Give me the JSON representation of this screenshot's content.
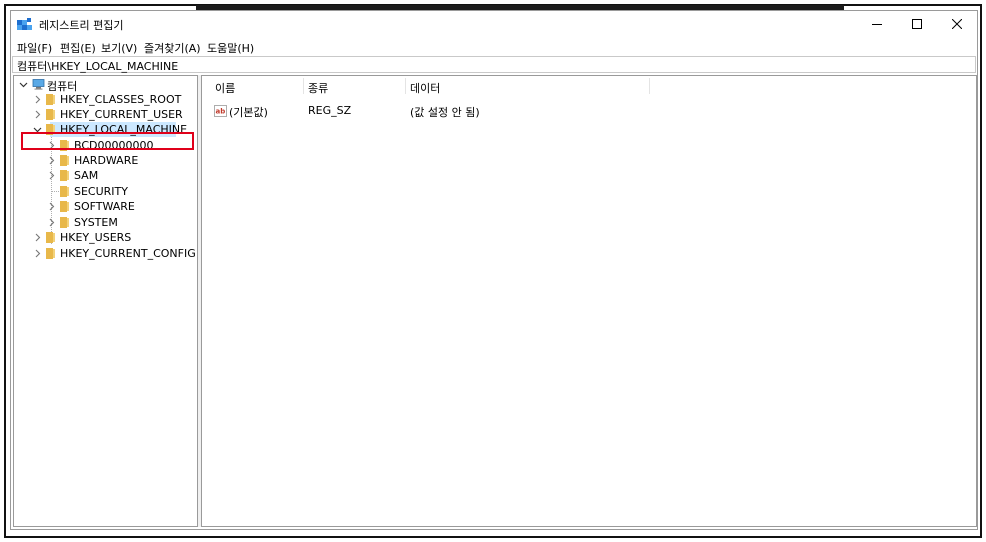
{
  "window": {
    "title": "레지스트리 편집기",
    "controls": [
      "minimize",
      "maximize",
      "close"
    ]
  },
  "menu": [
    "파일(F)",
    "편집(E)",
    "보기(V)",
    "즐겨찾기(A)",
    "도움말(H)"
  ],
  "address": "컴퓨터\\HKEY_LOCAL_MACHINE",
  "tree": {
    "root": "컴퓨터",
    "hives": [
      "HKEY_CLASSES_ROOT",
      "HKEY_CURRENT_USER",
      "HKEY_LOCAL_MACHINE"
    ],
    "local_machine_children": [
      "BCD00000000",
      "HARDWARE",
      "SAM",
      "SECURITY",
      "SOFTWARE",
      "SYSTEM"
    ],
    "hives_after": [
      "HKEY_USERS",
      "HKEY_CURRENT_CONFIG"
    ],
    "selected": "HKEY_LOCAL_MACHINE"
  },
  "list": {
    "columns": [
      "이름",
      "종류",
      "데이터"
    ],
    "rows": [
      {
        "icon": "ab",
        "name": "(기본값)",
        "type": "REG_SZ",
        "data": "(값 설정 안 됨)"
      }
    ]
  },
  "colors": {
    "selection": "#cce8ff",
    "highlight_border": "#e0001a",
    "folder": "#e8b84a",
    "string_icon": "#c0392b"
  }
}
